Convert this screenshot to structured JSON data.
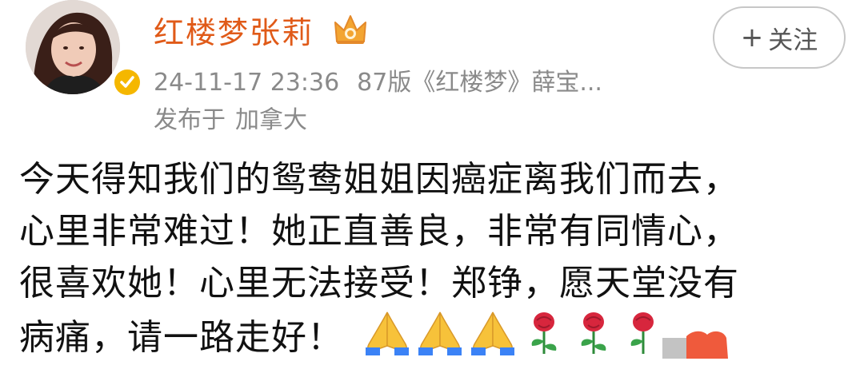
{
  "header": {
    "username": "红楼梦张莉",
    "timestamp": "24-11-17 23:36",
    "source": "87版《红楼梦》薛宝...",
    "location_label": "发布于",
    "location_value": "加拿大"
  },
  "follow_button": {
    "plus": "+",
    "label": "关注"
  },
  "post": {
    "lines": [
      "今天得知我们的鸳鸯姐姐因癌症离我们而去，",
      "心里非常难过！她正直善良，非常有同情心，",
      "很喜欢她！心里无法接受！郑铮，愿天堂没有",
      "病痛，请一路走好！"
    ],
    "emojis": [
      "folded-hands",
      "folded-hands",
      "folded-hands",
      "rose",
      "rose",
      "rose"
    ]
  },
  "colors": {
    "username": "#e05a18",
    "meta": "#8a8a8a",
    "text": "#111111",
    "verified": "#f5b700",
    "button_border": "#c7c7c7"
  }
}
